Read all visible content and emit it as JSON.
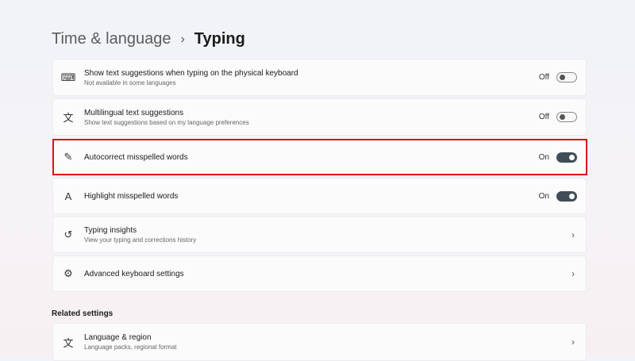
{
  "breadcrumb": {
    "parent": "Time & language",
    "separator": "›",
    "current": "Typing"
  },
  "rows": [
    {
      "label": "Show text suggestions when typing on the physical keyboard",
      "sub": "Not available in some languages",
      "state": "Off",
      "icon": "keyboard-icon"
    },
    {
      "label": "Multilingual text suggestions",
      "sub": "Show text suggestions based on my language preferences",
      "state": "Off",
      "icon": "language-icon"
    },
    {
      "label": "Autocorrect misspelled words",
      "state": "On",
      "icon": "autocorrect-icon"
    },
    {
      "label": "Highlight misspelled words",
      "state": "On",
      "icon": "highlight-icon"
    },
    {
      "label": "Typing insights",
      "sub": "View your typing and corrections history",
      "icon": "history-icon"
    },
    {
      "label": "Advanced keyboard settings",
      "icon": "gear-icon"
    }
  ],
  "related": {
    "heading": "Related settings",
    "items": [
      {
        "label": "Language & region",
        "sub": "Language packs, regional format",
        "icon": "language-icon"
      }
    ]
  },
  "colors": {
    "highlight": "#d6141c",
    "toggle_on": "#3f4d57"
  }
}
